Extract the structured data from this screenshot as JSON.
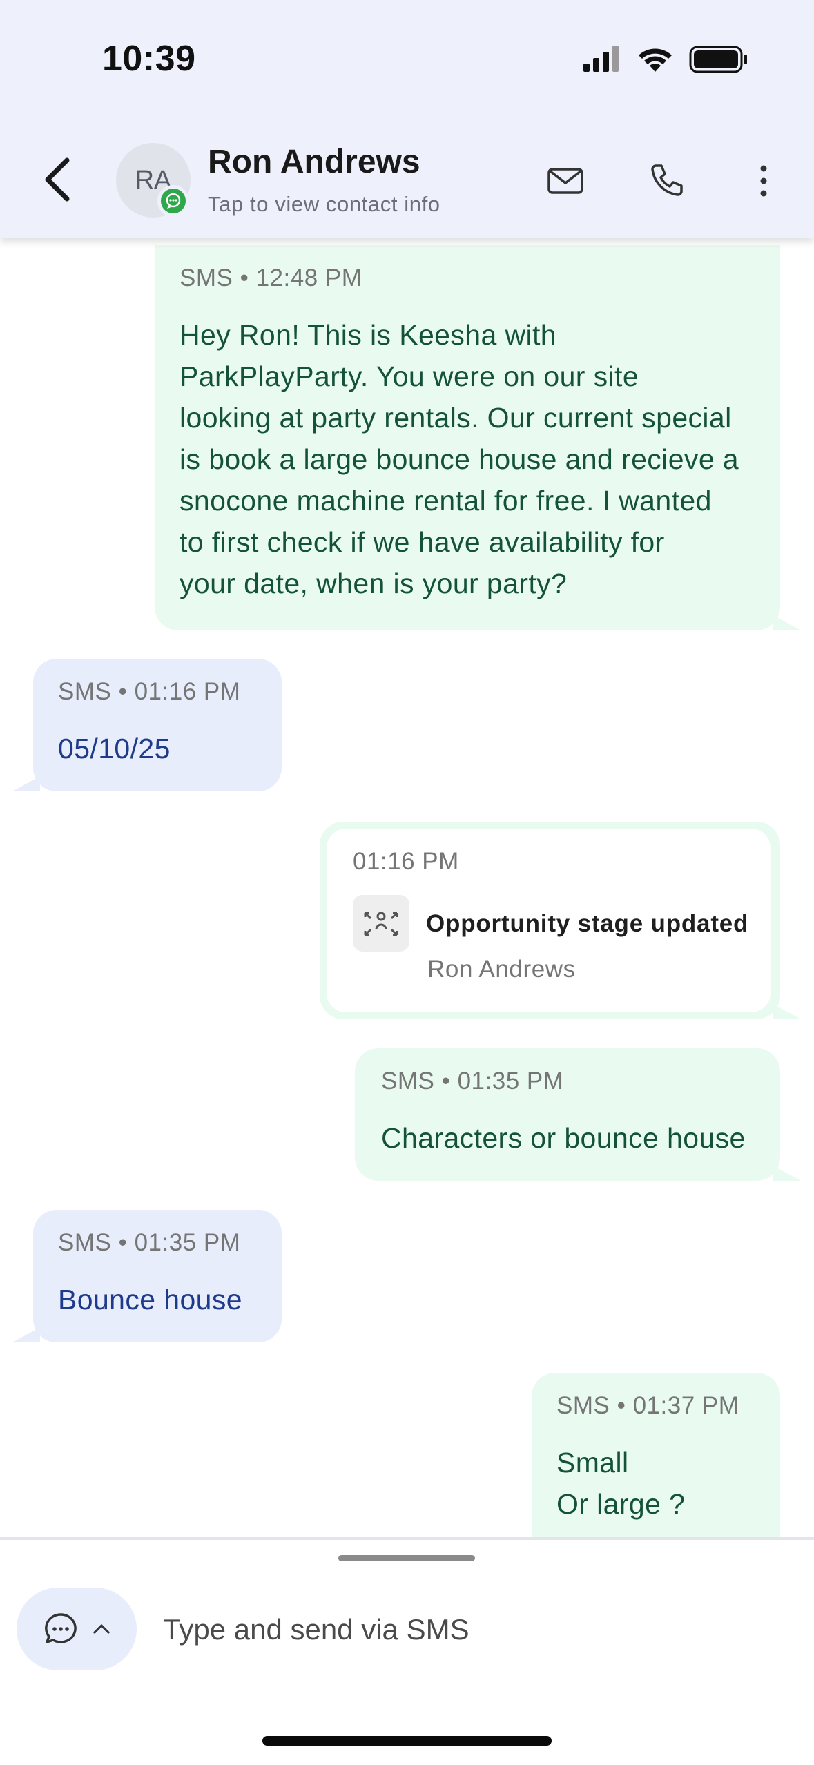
{
  "status_bar": {
    "time": "10:39"
  },
  "contact": {
    "initials": "RA",
    "name": "Ron Andrews",
    "subtitle": "Tap to view contact info"
  },
  "messages": [
    {
      "direction": "outgoing",
      "channel": "SMS",
      "time": "12:48 PM",
      "lines": [
        "Hey Ron! This is Keesha with",
        "ParkPlayParty. You were on our site",
        "looking at party rentals. Our current special",
        "is book a large bounce house and recieve a",
        "snocone machine rental for free.  I wanted",
        "to first check if we have availability for",
        "your date, when is your party?"
      ]
    },
    {
      "direction": "incoming",
      "channel": "SMS",
      "time": "01:16 PM",
      "lines": [
        "05/10/25"
      ]
    },
    {
      "direction": "activity",
      "time": "01:16 PM",
      "title": "Opportunity stage updated",
      "subtitle": "Ron Andrews"
    },
    {
      "direction": "outgoing",
      "channel": "SMS",
      "time": "01:35 PM",
      "lines": [
        "Characters or bounce house"
      ]
    },
    {
      "direction": "incoming",
      "channel": "SMS",
      "time": "01:35 PM",
      "lines": [
        "Bounce house"
      ]
    },
    {
      "direction": "outgoing",
      "channel": "SMS",
      "time": "01:37 PM",
      "lines": [
        "Small",
        "Or large ?"
      ]
    }
  ],
  "composer": {
    "placeholder": "Type and send via SMS"
  },
  "colors": {
    "header_bg": "#eef1fb",
    "outgoing_bubble": "#e9fbf1",
    "outgoing_text": "#14523a",
    "incoming_bubble": "#e8edfc",
    "incoming_text": "#1e3a8a",
    "badge_green": "#2ea84a"
  }
}
